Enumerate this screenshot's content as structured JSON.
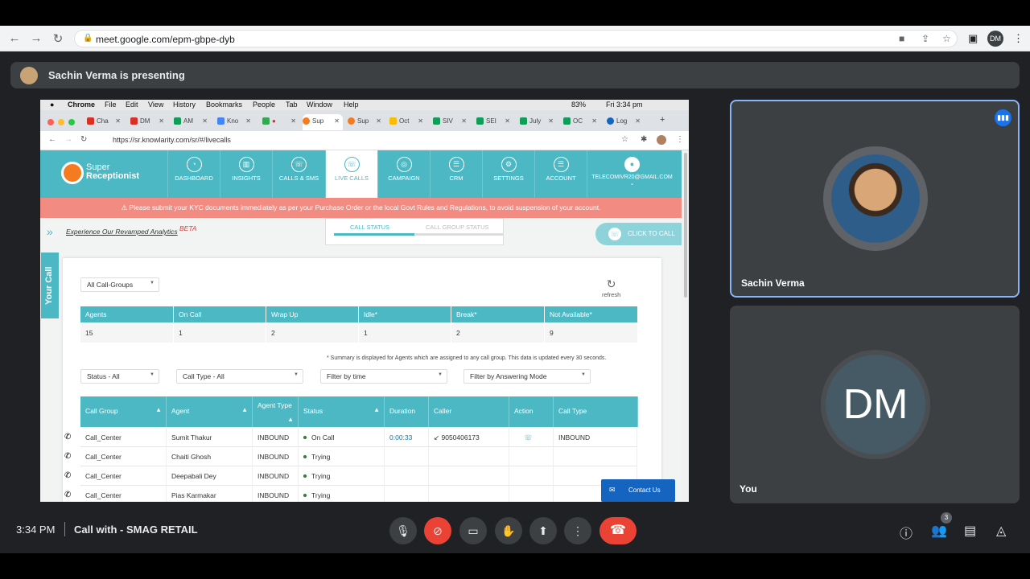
{
  "browser": {
    "url": "meet.google.com/epm-gbpe-dyb",
    "avatar": "DM"
  },
  "presenting": {
    "text": "Sachin Verma is presenting"
  },
  "shared": {
    "mac_menu": [
      "Chrome",
      "File",
      "Edit",
      "View",
      "History",
      "Bookmarks",
      "People",
      "Tab",
      "Window",
      "Help"
    ],
    "battery": "83%",
    "clock": "Fri 3:34 pm",
    "tabs": [
      "Cha",
      "DM",
      "AM",
      "Kno",
      "",
      "Sup",
      "Sup",
      "Oct",
      "SIV",
      "SEI",
      "July",
      "OC",
      "Log"
    ],
    "url": "https://sr.knowlarity.com/sr/#/livecalls",
    "logo": {
      "line1": "Super",
      "line2": "Receptionist"
    },
    "nav": [
      {
        "label": "DASHBOARD",
        "icon": "◔"
      },
      {
        "label": "INSIGHTS",
        "icon": "▥"
      },
      {
        "label": "CALLS & SMS",
        "icon": "☏"
      },
      {
        "label": "LIVE CALLS",
        "icon": "☏"
      },
      {
        "label": "CAMPAIGN",
        "icon": "◎"
      },
      {
        "label": "CRM",
        "icon": "☰"
      },
      {
        "label": "SETTINGS",
        "icon": "⚙"
      },
      {
        "label": "ACCOUNT",
        "icon": "☰"
      },
      {
        "label": "TELECOMIVR20@GMAIL.COM",
        "icon": "●"
      }
    ],
    "kyc": "⚠ Please submit your KYC documents immediately as per your Purchase Order or the local Govt Rules and Regulations, to avoid suspension of your account.",
    "beta_link": "Experience Our Revamped Analytics",
    "beta": "BETA",
    "status_tabs": [
      "CALL STATUS",
      "CALL GROUP STATUS"
    ],
    "click_to_call": "CLICK TO CALL",
    "your_call": "Your Call",
    "group_select": "All Call-Groups",
    "refresh": "refresh",
    "summary_headers": [
      "Agents",
      "On Call",
      "Wrap Up",
      "Idle*",
      "Break*",
      "Not Available*"
    ],
    "summary_values": [
      "15",
      "1",
      "2",
      "1",
      "2",
      "9"
    ],
    "note": "* Summary is displayed for Agents which are assigned to any call group. This data is updated every 30 seconds.",
    "filters": [
      "Status - All",
      "Call Type - All",
      "Filter by time",
      "Filter by Answering Mode"
    ],
    "table_headers": [
      "Call Group",
      "Agent",
      "Agent Type",
      "Status",
      "Duration",
      "Caller",
      "Action",
      "Call Type"
    ],
    "rows": [
      {
        "group": "Call_Center",
        "agent": "Sumit  Thakur",
        "type": "INBOUND",
        "status": "On Call",
        "duration": "0:00:33",
        "caller": "↙ 9050406173",
        "calltype": "INBOUND"
      },
      {
        "group": "Call_Center",
        "agent": "Chaiti  Ghosh",
        "type": "INBOUND",
        "status": "Trying",
        "duration": "",
        "caller": "",
        "calltype": ""
      },
      {
        "group": "Call_Center",
        "agent": "Deepabali  Dey",
        "type": "INBOUND",
        "status": "Trying",
        "duration": "",
        "caller": "",
        "calltype": ""
      },
      {
        "group": "Call_Center",
        "agent": "Pias  Karmakar",
        "type": "INBOUND",
        "status": "Trying",
        "duration": "",
        "caller": "",
        "calltype": ""
      }
    ],
    "contact": "Contact Us"
  },
  "tiles": [
    {
      "name": "Sachin Verma"
    },
    {
      "name": "You",
      "initials": "DM"
    }
  ],
  "bottom": {
    "time": "3:34 PM",
    "title": "Call with - SMAG RETAIL",
    "participants": "3"
  }
}
